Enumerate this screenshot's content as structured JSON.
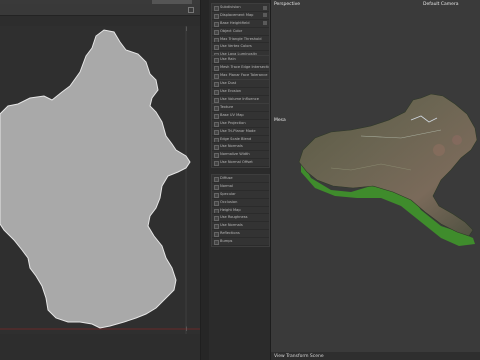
{
  "viewport": {
    "title": "Perspective",
    "camera": "Default Camera",
    "label": "Mesa",
    "status": "View Transform Scene"
  },
  "props": {
    "group1": [
      "Subdivision",
      "Displacement Map",
      "Base Heightfield",
      "Object Color",
      "Max Triangle Threshold",
      "Use Vertex Colors",
      "Use Lava Luminosity",
      "Use Wind"
    ],
    "group2": [
      "Use Rain",
      "Mesh Trace Edge Intersections",
      "Max Planar Face Tolerance"
    ],
    "group3": [
      "Use Dust",
      "Use Erosion",
      "Use Volume Influence"
    ],
    "group4": [
      "Texture",
      "Base UV Map",
      "Use Projection",
      "Use Tri-Planar Mode",
      "Edge Scale Blend",
      "Use Normals",
      "Normalize Width",
      "Use Normal Offset"
    ],
    "group5": [
      "Diffuse",
      "Normal",
      "Specular",
      "Occlusion",
      "Height Map",
      "Use Roughness",
      "Use Normals",
      "Reflections",
      "Bumps"
    ]
  },
  "colors": {
    "map_fill": "#a9a9a9",
    "terrain_green": "#3f8c2c"
  }
}
